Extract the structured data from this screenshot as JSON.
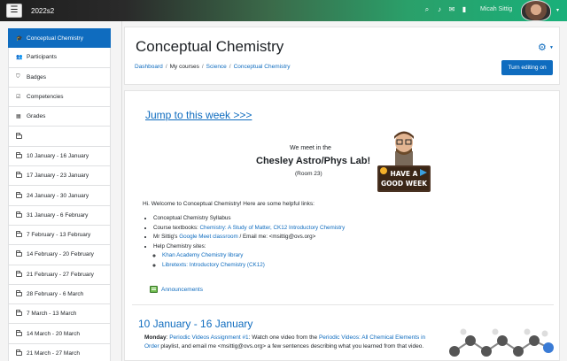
{
  "navbar": {
    "menu_icon": "hamburger-icon",
    "brand": "2022s2",
    "icons": [
      "search-icon",
      "bell-icon",
      "chat-icon",
      "bookmark-icon"
    ],
    "user_name": "Micah Sittig",
    "caret": "▾"
  },
  "drawer": {
    "items": [
      {
        "label": "Conceptual Chemistry",
        "icon": "graduation-cap-icon",
        "active": true
      },
      {
        "label": "Participants",
        "icon": "users-icon"
      },
      {
        "label": "Badges",
        "icon": "shield-icon"
      },
      {
        "label": "Competencies",
        "icon": "check-square-icon"
      },
      {
        "label": "Grades",
        "icon": "table-icon"
      },
      {
        "label": "",
        "icon": "folder-icon"
      },
      {
        "label": "10 January - 16 January",
        "icon": "folder-icon"
      },
      {
        "label": "17 January - 23 January",
        "icon": "folder-icon"
      },
      {
        "label": "24 January - 30 January",
        "icon": "folder-icon"
      },
      {
        "label": "31 January - 6 February",
        "icon": "folder-icon"
      },
      {
        "label": "7 February - 13 February",
        "icon": "folder-icon"
      },
      {
        "label": "14 February - 20 February",
        "icon": "folder-icon"
      },
      {
        "label": "21 February - 27 February",
        "icon": "folder-icon"
      },
      {
        "label": "28 February - 6 March",
        "icon": "folder-icon"
      },
      {
        "label": "7 March - 13 March",
        "icon": "folder-icon"
      },
      {
        "label": "14 March - 20 March",
        "icon": "folder-icon"
      },
      {
        "label": "21 March - 27 March",
        "icon": "folder-icon"
      }
    ]
  },
  "header": {
    "title": "Conceptual Chemistry",
    "breadcrumb": [
      "Dashboard",
      "My courses",
      "Science",
      "Conceptual Chemistry"
    ],
    "edit_button": "Turn editing on",
    "gear_icon": "gear-icon"
  },
  "section0": {
    "jump_link": "Jump to this week >>>",
    "meet_line1": "We meet in the",
    "meet_line2": "Chesley Astro/Phys Lab!",
    "meet_line3": "(Room 23)",
    "bitmoji_sign_line1": "HAVE A",
    "bitmoji_sign_line2": "GOOD WEEK",
    "welcome": "Hi. Welcome to Conceptual Chemistry! Here are some helpful links:",
    "links": {
      "syllabus": "Conceptual Chemistry Syllabus",
      "textbooks_label": "Course textbooks: ",
      "textbooks_link": "Chemistry: A Study of Matter, CK12 Introductory Chemistry",
      "classroom_prefix": "Mr Sittig's ",
      "classroom_link": "Google Meet classroom",
      "classroom_suffix": " / Email me: <msittig@ovs.org>",
      "help": "Help Chemistry sites:",
      "khan": "Khan Academy Chemistry library",
      "libretexts": "Libretexts: Introductory Chemistry (CK12)"
    },
    "announcements": "Announcements"
  },
  "week1": {
    "title": "10 January - 16 January",
    "day": "Monday",
    "link1": "Periodic Videos Assignment #1",
    "text1": ": Watch one video from the ",
    "link2": "Periodic Videos: All Chemical Elements in Order",
    "text2": " playlist, and email me <msittig@ovs.org> a few sentences describing what you learned from that video."
  }
}
